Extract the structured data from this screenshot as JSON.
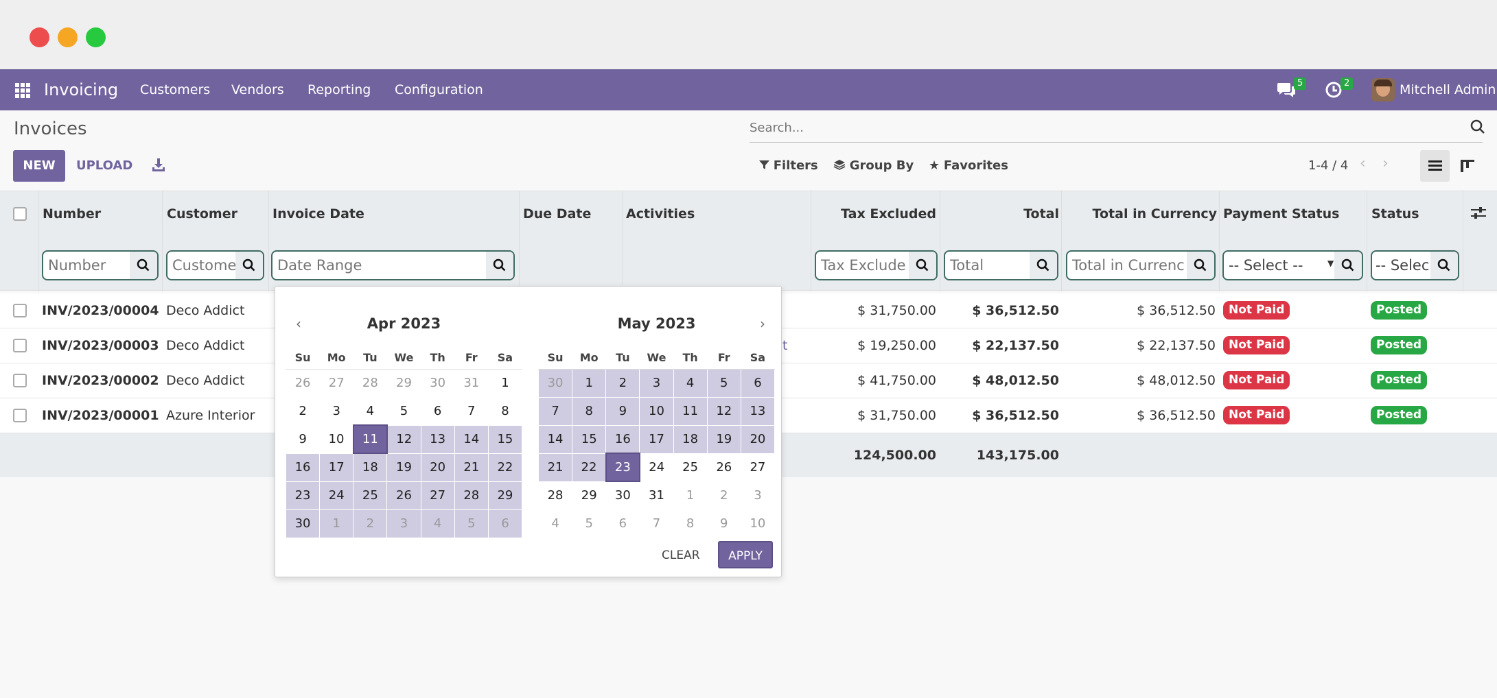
{
  "window": {
    "colors": {
      "close": "#ee4d4d",
      "minimize": "#f5a623",
      "maximize": "#27c93f"
    }
  },
  "navbar": {
    "app_name": "Invoicing",
    "menu": [
      "Customers",
      "Vendors",
      "Reporting",
      "Configuration"
    ],
    "messages_count": "5",
    "activities_count": "2",
    "user_name": "Mitchell Admin",
    "accent": "#71639e"
  },
  "control": {
    "title": "Invoices",
    "new_label": "NEW",
    "upload_label": "UPLOAD",
    "search_placeholder": "Search...",
    "filters_label": "Filters",
    "groupby_label": "Group By",
    "favorites_label": "Favorites",
    "pager": "1-4 / 4"
  },
  "table": {
    "columns": [
      "Number",
      "Customer",
      "Invoice Date",
      "Due Date",
      "Activities",
      "Tax Excluded",
      "Total",
      "Total in Currency",
      "Payment Status",
      "Status"
    ],
    "filters": {
      "number": "Number",
      "customer": "Custome",
      "invoice_date": "Date Range",
      "tax_excluded": "Tax Exclude",
      "total": "Total",
      "total_currency": "Total in Currenc",
      "payment_status": "-- Select --",
      "status": "-- Selec"
    },
    "rows": [
      {
        "number": "INV/2023/00004",
        "customer": "Deco Addict",
        "tax_excluded": "$ 31,750.00",
        "total": "$ 36,512.50",
        "total_currency": "$ 36,512.50",
        "payment_status": "Not Paid",
        "status": "Posted"
      },
      {
        "number": "INV/2023/00003",
        "customer": "Deco Addict",
        "activity_fragment": "t",
        "tax_excluded": "$ 19,250.00",
        "total": "$ 22,137.50",
        "total_currency": "$ 22,137.50",
        "payment_status": "Not Paid",
        "status": "Posted"
      },
      {
        "number": "INV/2023/00002",
        "customer": "Deco Addict",
        "tax_excluded": "$ 41,750.00",
        "total": "$ 48,012.50",
        "total_currency": "$ 48,012.50",
        "payment_status": "Not Paid",
        "status": "Posted"
      },
      {
        "number": "INV/2023/00001",
        "customer": "Azure Interior",
        "tax_excluded": "$ 31,750.00",
        "total": "$ 36,512.50",
        "total_currency": "$ 36,512.50",
        "payment_status": "Not Paid",
        "status": "Posted"
      }
    ],
    "totals": {
      "tax_excluded": "124,500.00",
      "total": "143,175.00"
    }
  },
  "datepicker": {
    "weekdays": [
      "Su",
      "Mo",
      "Tu",
      "We",
      "Th",
      "Fr",
      "Sa"
    ],
    "left": {
      "title": "Apr 2023",
      "weeks": [
        [
          "26",
          "27",
          "28",
          "29",
          "30",
          "31",
          "1"
        ],
        [
          "2",
          "3",
          "4",
          "5",
          "6",
          "7",
          "8"
        ],
        [
          "9",
          "10",
          "11",
          "12",
          "13",
          "14",
          "15"
        ],
        [
          "16",
          "17",
          "18",
          "19",
          "20",
          "21",
          "22"
        ],
        [
          "23",
          "24",
          "25",
          "26",
          "27",
          "28",
          "29"
        ],
        [
          "30",
          "1",
          "2",
          "3",
          "4",
          "5",
          "6"
        ]
      ]
    },
    "right": {
      "title": "May 2023",
      "weeks": [
        [
          "30",
          "1",
          "2",
          "3",
          "4",
          "5",
          "6"
        ],
        [
          "7",
          "8",
          "9",
          "10",
          "11",
          "12",
          "13"
        ],
        [
          "14",
          "15",
          "16",
          "17",
          "18",
          "19",
          "20"
        ],
        [
          "21",
          "22",
          "23",
          "24",
          "25",
          "26",
          "27"
        ],
        [
          "28",
          "29",
          "30",
          "31",
          "1",
          "2",
          "3"
        ],
        [
          "4",
          "5",
          "6",
          "7",
          "8",
          "9",
          "10"
        ]
      ]
    },
    "range_start": "2023-04-11",
    "range_end": "2023-05-23",
    "clear_label": "CLEAR",
    "apply_label": "APPLY"
  }
}
